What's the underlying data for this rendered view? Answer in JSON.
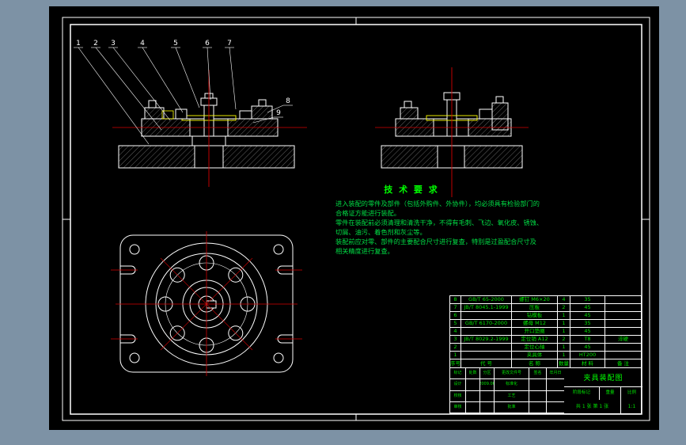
{
  "colors": {
    "viewer_background": "#7d92a5",
    "canvas": "#000000",
    "line_white": "#ffffff",
    "accent_yellow": "#ffff00",
    "centerline_red": "#d40000",
    "text_green": "#00e400"
  },
  "drawing": {
    "callouts": [
      "1",
      "2",
      "3",
      "4",
      "5",
      "6",
      "7",
      "8",
      "9"
    ]
  },
  "tech": {
    "title": "技 术 要 求",
    "lines": [
      "进入装配的零件及部件（包括外购件、外协件），均必须具有检验部门的",
      "合格证方能进行装配。",
      "零件在装配前必须清理和清洗干净，不得有毛刺、飞边、氧化皮、锈蚀、",
      "切屑、油污、着色剂和灰尘等。",
      "装配前应对零、部件的主要配合尺寸进行复查，特别是过盈配合尺寸及",
      "相关精度进行复查。"
    ]
  },
  "parts": {
    "header": [
      "序号",
      "代  号",
      "名  称",
      "数量",
      "材  料",
      "备  注"
    ],
    "rows": [
      [
        "8",
        "GB/T 65-2000",
        "螺钉 M6×20",
        "4",
        "35",
        ""
      ],
      [
        "7",
        "JB/T 8045.1-1999",
        "压板",
        "2",
        "45",
        ""
      ],
      [
        "6",
        "",
        "钻模板",
        "1",
        "45",
        ""
      ],
      [
        "5",
        "GB/T 6170-2000",
        "螺母 M12",
        "1",
        "35",
        ""
      ],
      [
        "4",
        "",
        "开口垫圈",
        "1",
        "45",
        ""
      ],
      [
        "3",
        "JB/T 8029.2-1999",
        "定位销 A12",
        "2",
        "T8",
        "淬硬"
      ],
      [
        "2",
        "",
        "定位心轴",
        "1",
        "45",
        ""
      ],
      [
        "1",
        "",
        "夹具体",
        "1",
        "HT200",
        ""
      ]
    ]
  },
  "title_block": {
    "name": "夹具装配图",
    "stage_label": "阶段标记",
    "weight_label": "重量",
    "scale_label": "比例",
    "scale_value": "1:1",
    "sheet_text": "共 1 张  第 1 张",
    "rev_header": [
      "标记",
      "处数",
      "分区",
      "更改文件号",
      "签名",
      "年月日"
    ],
    "sign_rows": [
      [
        "设计",
        "",
        "2009.06",
        "标准化",
        "",
        ""
      ],
      [
        "校核",
        "",
        "",
        "工艺",
        "",
        ""
      ],
      [
        "审核",
        "",
        "",
        "批准",
        "",
        ""
      ]
    ]
  }
}
